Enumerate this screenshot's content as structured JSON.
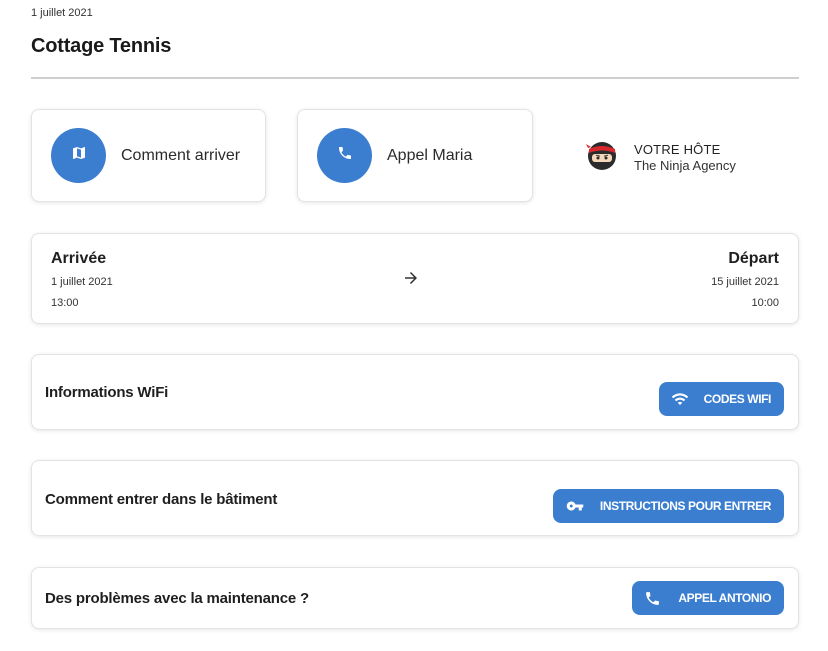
{
  "header": {
    "date": "1 juillet 2021",
    "title": "Cottage Tennis"
  },
  "actions": [
    {
      "label": "Comment arriver",
      "icon": "map-icon"
    },
    {
      "label": "Appel Maria",
      "icon": "phone-icon"
    }
  ],
  "host": {
    "kicker": "VOTRE HÔTE",
    "name": "The Ninja Agency",
    "icon": "ninja-avatar-icon"
  },
  "stay": {
    "arrival_label": "Arrivée",
    "arrival_date": "1 juillet 2021",
    "arrival_time": "13:00",
    "departure_label": "Départ",
    "departure_date": "15 juillet 2021",
    "departure_time": "10:00"
  },
  "sections": [
    {
      "title": "Informations WiFi",
      "button": "CODES WIFI",
      "icon": "wifi-icon"
    },
    {
      "title": "Comment entrer dans le bâtiment",
      "button": "INSTRUCTIONS POUR ENTRER",
      "icon": "key-icon"
    },
    {
      "title": "Des problèmes avec la maintenance ?",
      "button": "APPEL ANTONIO",
      "icon": "phone-icon"
    }
  ],
  "colors": {
    "accent": "#3b7ed0",
    "divider": "#cfcfcf",
    "card_border": "#e3e3e3"
  }
}
